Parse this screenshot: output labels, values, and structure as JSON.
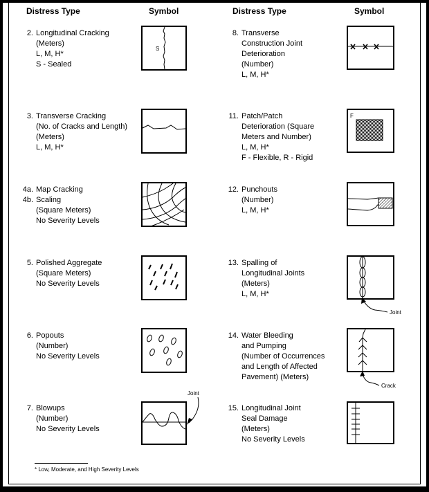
{
  "headers": {
    "left_type": "Distress Type",
    "left_symbol": "Symbol",
    "right_type": "Distress Type",
    "right_symbol": "Symbol"
  },
  "left": [
    {
      "num": "2.",
      "lines": [
        "Longitudinal Cracking",
        "(Meters)",
        "L, M, H*",
        "S - Sealed"
      ],
      "symbol": "longitudinal-crack",
      "symbol_text": "S"
    },
    {
      "num": "3.",
      "lines": [
        "Transverse Cracking",
        "(No. of Cracks and Length)",
        "(Meters)",
        "L, M, H*"
      ],
      "symbol": "transverse-crack"
    },
    {
      "num": "4a.",
      "num2": "4b.",
      "lines": [
        "Map Cracking",
        "Scaling",
        "(Square Meters)",
        "No Severity Levels"
      ],
      "symbol": "map-cracking"
    },
    {
      "num": "5.",
      "lines": [
        "Polished Aggregate",
        "(Square Meters)",
        "No Severity Levels"
      ],
      "symbol": "polished-aggregate"
    },
    {
      "num": "6.",
      "lines": [
        "Popouts",
        "(Number)",
        "No Severity Levels"
      ],
      "symbol": "popouts"
    },
    {
      "num": "7.",
      "lines": [
        "Blowups",
        "(Number)",
        "No Severity Levels"
      ],
      "symbol": "blowups",
      "callout": "Joint"
    }
  ],
  "right": [
    {
      "num": "8.",
      "lines": [
        "Transverse",
        "Construction Joint",
        "Deterioration",
        "(Number)",
        "L, M, H*"
      ],
      "symbol": "joint-deterioration"
    },
    {
      "num": "11.",
      "lines": [
        "Patch/Patch",
        "Deterioration (Square",
        "Meters and Number)",
        "L, M, H*",
        "F - Flexible, R - Rigid"
      ],
      "symbol": "patch",
      "symbol_text": "F"
    },
    {
      "num": "12.",
      "lines": [
        "Punchouts",
        "(Number)",
        "L, M, H*"
      ],
      "symbol": "punchout"
    },
    {
      "num": "13.",
      "lines": [
        "Spalling of",
        "Longitudinal Joints",
        "(Meters)",
        "L, M, H*"
      ],
      "symbol": "spalling",
      "callout": "Joint"
    },
    {
      "num": "14.",
      "lines": [
        "Water Bleeding",
        "and Pumping",
        "(Number of Occurrences",
        "and Length of Affected",
        "Pavement) (Meters)"
      ],
      "symbol": "water-bleeding",
      "callout": "Crack"
    },
    {
      "num": "15.",
      "lines": [
        "Longitudinal Joint",
        "Seal Damage",
        "(Meters)",
        "No Severity Levels"
      ],
      "symbol": "joint-seal-damage"
    }
  ],
  "footnote": "* Low, Moderate, and High Severity Levels"
}
